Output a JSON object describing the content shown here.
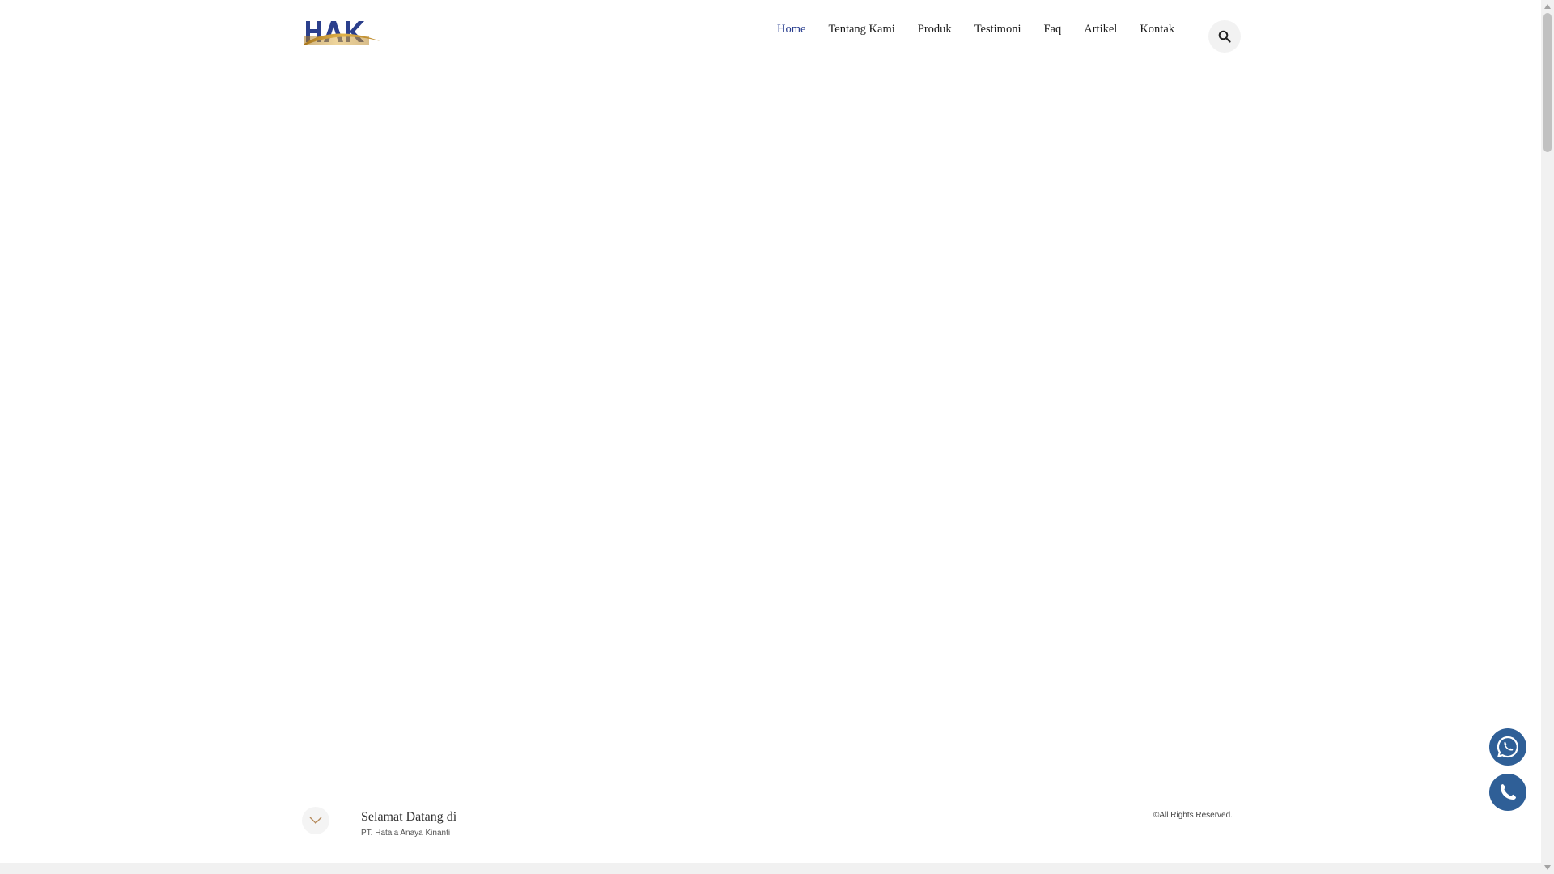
{
  "brand": {
    "logo_text": "HAK"
  },
  "nav": {
    "items": [
      {
        "label": "Home",
        "active": true
      },
      {
        "label": "Tentang Kami"
      },
      {
        "label": "Produk"
      },
      {
        "label": "Testimoni"
      },
      {
        "label": "Faq"
      },
      {
        "label": "Artikel"
      },
      {
        "label": "Kontak"
      }
    ]
  },
  "icons": {
    "search": "search-icon",
    "scroll_down": "chevron-down-icon",
    "whatsapp": "whatsapp-icon",
    "phone": "phone-icon"
  },
  "hero": {
    "welcome_title": "Selamat Datang di",
    "company_name": "PT. Hatala Anaya Kinanti"
  },
  "footer": {
    "copyright": "©All Rights Reserved."
  },
  "colors": {
    "nav_active": "#2a3f8f",
    "logo_blue": "#2b3f8c",
    "logo_gold": "#c8952a",
    "float_button": "#2f5f97"
  }
}
